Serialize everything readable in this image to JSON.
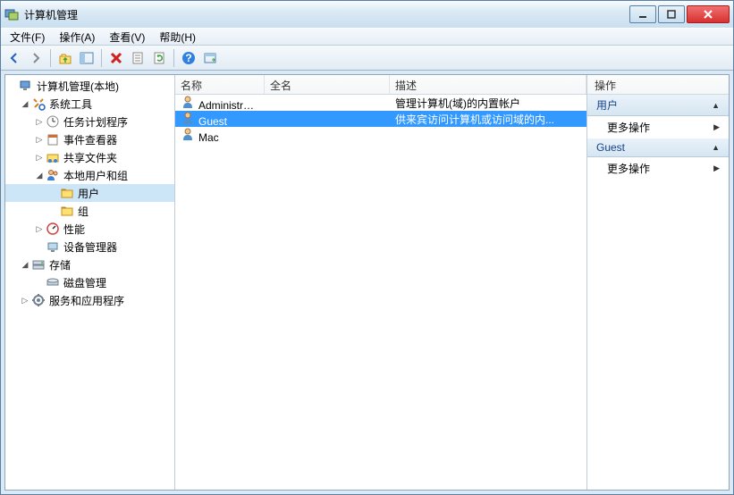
{
  "window": {
    "title": "计算机管理"
  },
  "menu": {
    "file": "文件(F)",
    "action": "操作(A)",
    "view": "查看(V)",
    "help": "帮助(H)"
  },
  "tree": {
    "root": "计算机管理(本地)",
    "systools": "系统工具",
    "tasksched": "任务计划程序",
    "eventviewer": "事件查看器",
    "sharedfolders": "共享文件夹",
    "localusers": "本地用户和组",
    "users": "用户",
    "groups": "组",
    "perf": "性能",
    "devmgr": "设备管理器",
    "storage": "存储",
    "diskmgmt": "磁盘管理",
    "services": "服务和应用程序"
  },
  "list": {
    "headers": {
      "name": "名称",
      "fullname": "全名",
      "desc": "描述"
    },
    "rows": [
      {
        "name": "Administrat...",
        "fullname": "",
        "desc": "管理计算机(域)的内置帐户",
        "selected": false
      },
      {
        "name": "Guest",
        "fullname": "",
        "desc": "供来宾访问计算机或访问域的内...",
        "selected": true
      },
      {
        "name": "Mac",
        "fullname": "",
        "desc": "",
        "selected": false
      }
    ]
  },
  "actions": {
    "header": "操作",
    "section1": "用户",
    "more1": "更多操作",
    "section2": "Guest",
    "more2": "更多操作"
  }
}
